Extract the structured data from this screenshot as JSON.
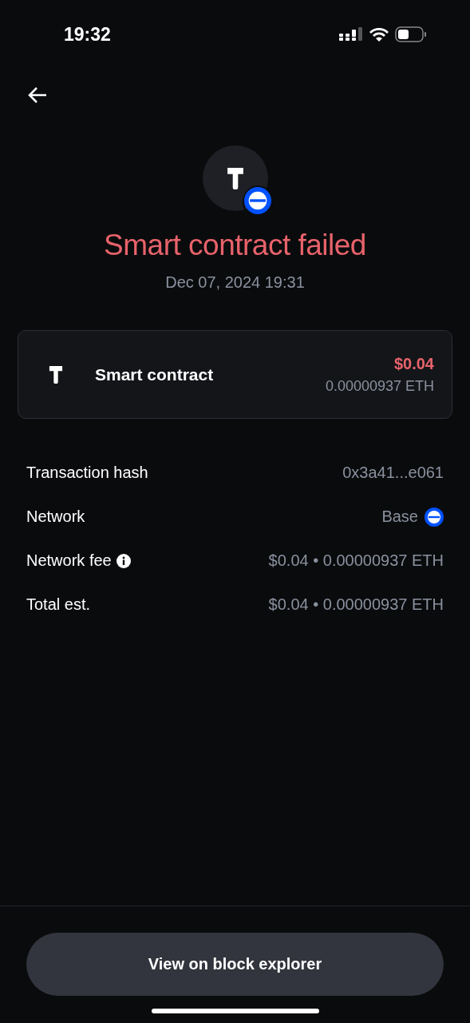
{
  "status_bar": {
    "time": "19:32"
  },
  "header": {
    "title": "Smart contract failed",
    "date": "Dec 07, 2024 19:31"
  },
  "summary": {
    "label": "Smart contract",
    "amount": "$0.04",
    "amount_crypto": "0.00000937 ETH"
  },
  "details": [
    {
      "kind": "text",
      "label": "Transaction hash",
      "value": "0x3a41...e061"
    },
    {
      "kind": "network",
      "label": "Network",
      "value": "Base"
    },
    {
      "kind": "info",
      "label": "Network fee",
      "value": "$0.04 • 0.00000937 ETH"
    },
    {
      "kind": "text",
      "label": "Total est.",
      "value": "$0.04 • 0.00000937 ETH"
    }
  ],
  "button": {
    "label": "View on block explorer"
  }
}
